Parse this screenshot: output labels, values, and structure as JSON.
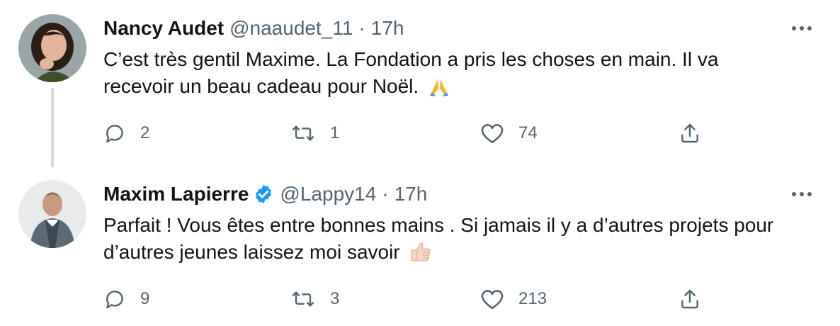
{
  "tweets": [
    {
      "name": "Nancy Audet",
      "verified": false,
      "handle": "@naaudet_11",
      "separator": "·",
      "time": "17h",
      "text": "C’est très gentil Maxime. La Fondation a pris les choses en main. Il va recevoir un beau cadeau pour Noël.",
      "emoji": "folded-hands",
      "replies": "2",
      "retweets": "1",
      "likes": "74"
    },
    {
      "name": "Maxim Lapierre",
      "verified": true,
      "handle": "@Lappy14",
      "separator": "·",
      "time": "17h",
      "text": "Parfait ! Vous êtes entre bonnes mains . Si jamais il y a d’autres projets pour d’autres jeunes laissez moi savoir",
      "emoji": "thumbs-up",
      "replies": "9",
      "retweets": "3",
      "likes": "213"
    }
  ],
  "colors": {
    "text": "#0f1419",
    "secondary": "#536471",
    "verified": "#1d9bf0",
    "thread_line": "#cfd9de"
  },
  "icons": {
    "reply": "reply-icon",
    "retweet": "retweet-icon",
    "like": "heart-icon",
    "share": "share-icon",
    "more": "more-icon"
  }
}
